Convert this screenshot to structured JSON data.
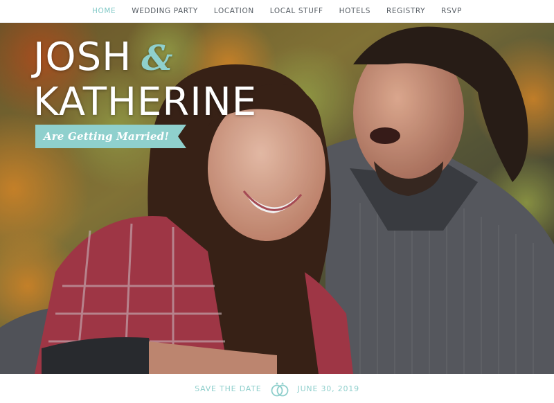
{
  "nav": {
    "items": [
      {
        "label": "HOME",
        "active": true
      },
      {
        "label": "WEDDING PARTY",
        "active": false
      },
      {
        "label": "LOCATION",
        "active": false
      },
      {
        "label": "LOCAL STUFF",
        "active": false
      },
      {
        "label": "HOTELS",
        "active": false
      },
      {
        "label": "REGISTRY",
        "active": false
      },
      {
        "label": "RSVP",
        "active": false
      }
    ]
  },
  "hero": {
    "name_one": "JOSH",
    "ampersand": "&",
    "name_two": "KATHERINE",
    "ribbon_text": "Are Getting Married!"
  },
  "footer": {
    "save_the_date": "SAVE THE DATE",
    "date": "JUNE 30, 2019",
    "rings_icon": "wedding-rings-icon"
  },
  "colors": {
    "accent": "#8fd0cd",
    "nav_text": "#555c63",
    "white": "#ffffff"
  }
}
